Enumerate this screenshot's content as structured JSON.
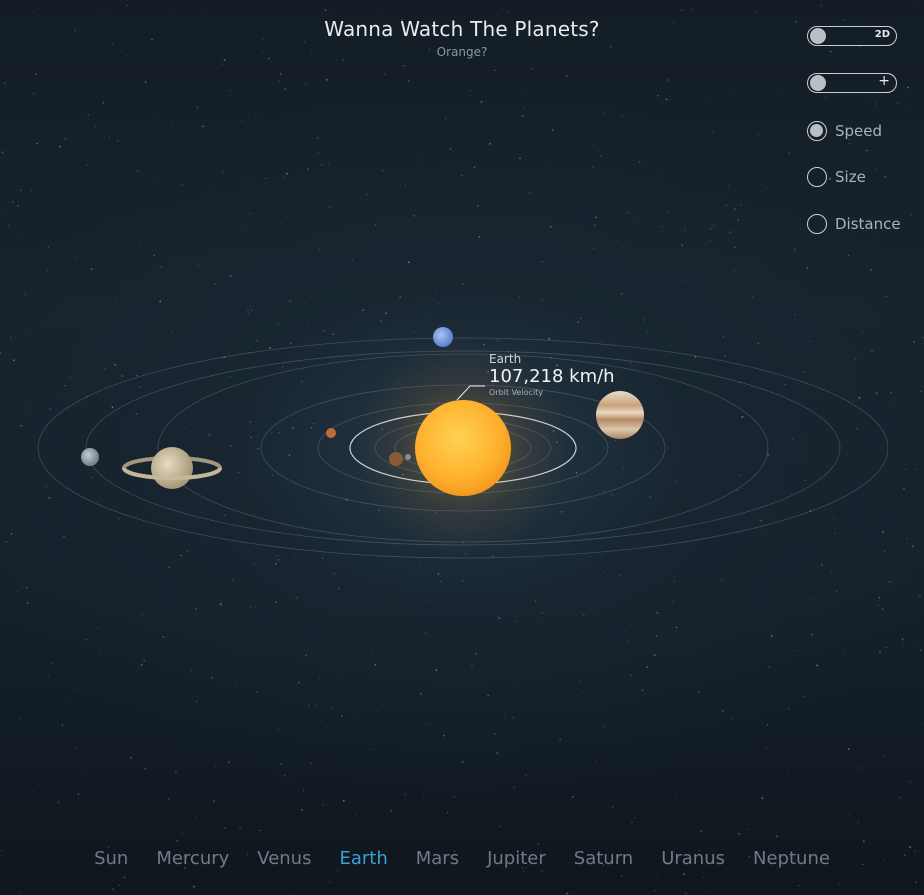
{
  "header": {
    "title": "Wanna Watch The Planets?",
    "subtitle": "Orange?"
  },
  "controls": {
    "view_toggle_label": "2D",
    "zoom_toggle_label": "+",
    "options": [
      {
        "label": "Speed",
        "checked": true
      },
      {
        "label": "Size",
        "checked": false
      },
      {
        "label": "Distance",
        "checked": false
      }
    ]
  },
  "info": {
    "planet": "Earth",
    "value": "107,218 km/h",
    "metric": "Orbit Velocity"
  },
  "nav": {
    "items": [
      "Sun",
      "Mercury",
      "Venus",
      "Earth",
      "Mars",
      "Jupiter",
      "Saturn",
      "Uranus",
      "Neptune"
    ],
    "active": "Earth"
  },
  "colors": {
    "accent": "#3aa0d8",
    "sun": "#ffb12e",
    "background": "#15212b"
  }
}
